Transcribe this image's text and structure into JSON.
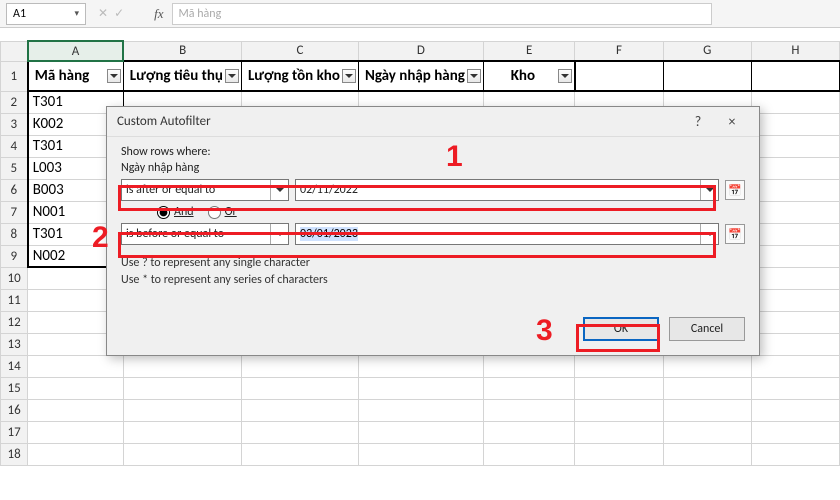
{
  "formula_bar": {
    "name_box": "A1",
    "fx_label": "fx",
    "formula_value": "Mã hàng"
  },
  "columns": [
    "A",
    "B",
    "C",
    "D",
    "E",
    "F",
    "G",
    "H"
  ],
  "headers": {
    "a": "Mã hàng",
    "b": "Lượng tiêu thụ",
    "c": "Lượng tồn kho",
    "d": "Ngày nhập hàng",
    "e": "Kho"
  },
  "rows": {
    "items": [
      "T301",
      "K002",
      "T301",
      "L003",
      "B003",
      "N001",
      "T301",
      "N002"
    ]
  },
  "dialog": {
    "title": "Custom Autofilter",
    "help_label": "?",
    "close_label": "×",
    "show_rows_where": "Show rows where:",
    "field_label": "Ngày nhập hàng",
    "cond1": "is after or equal to",
    "val1": "02/11/2022",
    "and_label": "And",
    "or_label": "Or",
    "and_checked": true,
    "cond2": "is before or equal to",
    "val2": "03/01/2023",
    "hint1": "Use ? to represent any single character",
    "hint2": "Use * to represent any series of characters",
    "ok": "OK",
    "cancel": "Cancel"
  },
  "annotations": {
    "n1": "1",
    "n2": "2",
    "n3": "3"
  }
}
